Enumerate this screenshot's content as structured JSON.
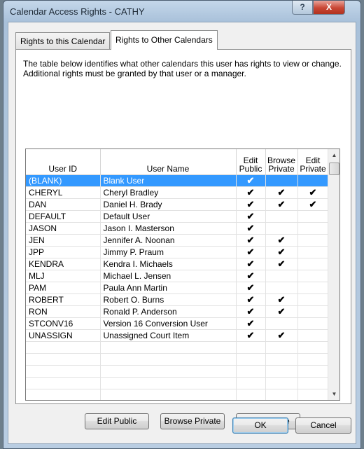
{
  "window": {
    "title": "Calendar Access Rights - CATHY",
    "help_symbol": "?",
    "close_symbol": "X"
  },
  "tabs": [
    {
      "label": "Rights to this Calendar",
      "active": false
    },
    {
      "label": "Rights to Other Calendars",
      "active": true
    }
  ],
  "description": "The table below identifies what other calendars this user has rights to view or change.  Additional rights must be granted by that user or a manager.",
  "table": {
    "columns": {
      "user_id": "User ID",
      "user_name": "User Name",
      "edit_public": "Edit Public",
      "browse_private": "Browse Private",
      "edit_private": "Edit Private"
    },
    "check_glyph": "✔",
    "rows": [
      {
        "id": "(BLANK)",
        "name": "Blank User",
        "edit_public": "✔",
        "browse_private": "",
        "edit_private": "",
        "selected": true
      },
      {
        "id": "CHERYL",
        "name": "Cheryl Bradley",
        "edit_public": "✔",
        "browse_private": "✔",
        "edit_private": "✔"
      },
      {
        "id": "DAN",
        "name": "Daniel H. Brady",
        "edit_public": "✔",
        "browse_private": "✔",
        "edit_private": "✔"
      },
      {
        "id": "DEFAULT",
        "name": "Default User",
        "edit_public": "✔",
        "browse_private": "",
        "edit_private": ""
      },
      {
        "id": "JASON",
        "name": "Jason I. Masterson",
        "edit_public": "✔",
        "browse_private": "",
        "edit_private": ""
      },
      {
        "id": "JEN",
        "name": "Jennifer A. Noonan",
        "edit_public": "✔",
        "browse_private": "✔",
        "edit_private": ""
      },
      {
        "id": "JPP",
        "name": "Jimmy P. Praum",
        "edit_public": "✔",
        "browse_private": "✔",
        "edit_private": ""
      },
      {
        "id": "KENDRA",
        "name": "Kendra I. Michaels",
        "edit_public": "✔",
        "browse_private": "✔",
        "edit_private": ""
      },
      {
        "id": "MLJ",
        "name": "Michael L. Jensen",
        "edit_public": "✔",
        "browse_private": "",
        "edit_private": ""
      },
      {
        "id": "PAM",
        "name": "Paula Ann Martin",
        "edit_public": "✔",
        "browse_private": "",
        "edit_private": ""
      },
      {
        "id": "ROBERT",
        "name": "Robert O. Burns",
        "edit_public": "✔",
        "browse_private": "✔",
        "edit_private": ""
      },
      {
        "id": "RON",
        "name": "Ronald P. Anderson",
        "edit_public": "✔",
        "browse_private": "✔",
        "edit_private": ""
      },
      {
        "id": "STCONV16",
        "name": "Version 16 Conversion User",
        "edit_public": "✔",
        "browse_private": "",
        "edit_private": ""
      },
      {
        "id": "UNASSIGN",
        "name": "Unassigned Court Item",
        "edit_public": "✔",
        "browse_private": "✔",
        "edit_private": ""
      }
    ]
  },
  "action_buttons": {
    "edit_public": "Edit Public",
    "browse_private": "Browse Private",
    "edit_private": "Edit Private"
  },
  "dialog_buttons": {
    "ok": "OK",
    "cancel": "Cancel"
  },
  "colors": {
    "selection": "#3399ff",
    "close_button": "#c94634"
  }
}
